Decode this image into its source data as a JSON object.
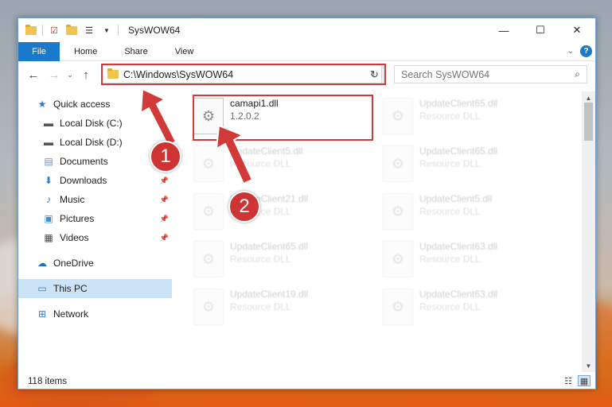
{
  "window": {
    "title": "SysWOW64"
  },
  "controls": {
    "minimize": "—",
    "maximize": "☐",
    "close": "✕"
  },
  "ribbon": {
    "file": "File",
    "tabs": [
      "Home",
      "Share",
      "View"
    ],
    "help": "?"
  },
  "nav": {
    "address": "C:\\Windows\\SysWOW64",
    "search_placeholder": "Search SysWOW64"
  },
  "sidebar": {
    "items": [
      {
        "label": "Quick access",
        "icon": "star-icon",
        "pinned": false
      },
      {
        "label": "Local Disk (C:)",
        "icon": "drive-icon",
        "pinned": false
      },
      {
        "label": "Local Disk (D:)",
        "icon": "drive-icon",
        "pinned": false
      },
      {
        "label": "Documents",
        "icon": "documents-icon",
        "pinned": false
      },
      {
        "label": "Downloads",
        "icon": "downloads-icon",
        "pinned": true
      },
      {
        "label": "Music",
        "icon": "music-icon",
        "pinned": true
      },
      {
        "label": "Pictures",
        "icon": "pictures-icon",
        "pinned": true
      },
      {
        "label": "Videos",
        "icon": "videos-icon",
        "pinned": true
      },
      {
        "label": "OneDrive",
        "icon": "onedrive-icon",
        "pinned": false
      },
      {
        "label": "This PC",
        "icon": "pc-icon",
        "pinned": false
      },
      {
        "label": "Network",
        "icon": "network-icon",
        "pinned": false
      }
    ]
  },
  "files": [
    {
      "name": "camapi1.dll",
      "sub": "1.2.0.2"
    },
    {
      "name": "UpdateClient65.dll",
      "sub": "Resource DLL"
    },
    {
      "name": "UpdateClient5.dll",
      "sub": "Resource DLL"
    },
    {
      "name": "UpdateClient65.dll",
      "sub": "Resource DLL"
    },
    {
      "name": "UpdateClient21.dll",
      "sub": "Resource DLL"
    },
    {
      "name": "UpdateClient5.dll",
      "sub": "Resource DLL"
    },
    {
      "name": "UpdateClient65.dll",
      "sub": "Resource DLL"
    },
    {
      "name": "UpdateClient63.dll",
      "sub": "Resource DLL"
    },
    {
      "name": "UpdateClient19.dll",
      "sub": "Resource DLL"
    },
    {
      "name": "UpdateClient63.dll",
      "sub": "Resource DLL"
    }
  ],
  "status": {
    "items": "118 items"
  },
  "annotations": {
    "step1": "1",
    "step2": "2",
    "highlight_color": "#d23a3a"
  }
}
